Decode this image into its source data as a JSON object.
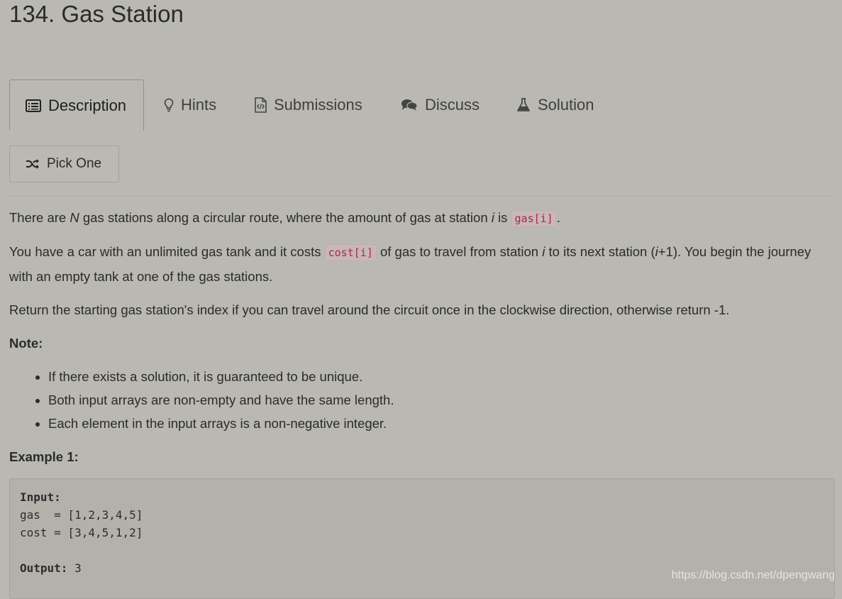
{
  "problem": {
    "title": "134. Gas Station"
  },
  "tabs": [
    {
      "label": "Description",
      "icon": "description-icon"
    },
    {
      "label": "Hints",
      "icon": "lightbulb-icon"
    },
    {
      "label": "Submissions",
      "icon": "code-file-icon"
    },
    {
      "label": "Discuss",
      "icon": "comments-icon"
    },
    {
      "label": "Solution",
      "icon": "flask-icon"
    }
  ],
  "pick_one": {
    "label": "Pick One",
    "icon": "shuffle-icon"
  },
  "description": {
    "p1_before": "There are ",
    "p1_n": "N",
    "p1_mid": " gas stations along a circular route, where the amount of gas at station ",
    "p1_i": "i",
    "p1_is": " is ",
    "p1_code": "gas[i]",
    "p1_end": ".",
    "p2_before": "You have a car with an unlimited gas tank and it costs ",
    "p2_code": "cost[i]",
    "p2_mid": " of gas to travel from station ",
    "p2_i": "i",
    "p2_mid2": " to its next station (",
    "p2_i2": "i",
    "p2_end": "+1). You begin the journey with an empty tank at one of the gas stations.",
    "p3": "Return the starting gas station's index if you can travel around the circuit once in the clockwise direction, otherwise return -1."
  },
  "note": {
    "title": "Note:",
    "items": [
      "If there exists a solution, it is guaranteed to be unique.",
      "Both input arrays are non-empty and have the same length.",
      "Each element in the input arrays is a non-negative integer."
    ]
  },
  "example": {
    "title": "Example 1:",
    "input_label": "Input:",
    "gas_line": "gas  = [1,2,3,4,5]",
    "cost_line": "cost = [3,4,5,1,2]",
    "output_label": "Output:",
    "output_value": " 3"
  },
  "watermark": "https://blog.csdn.net/dpengwang"
}
